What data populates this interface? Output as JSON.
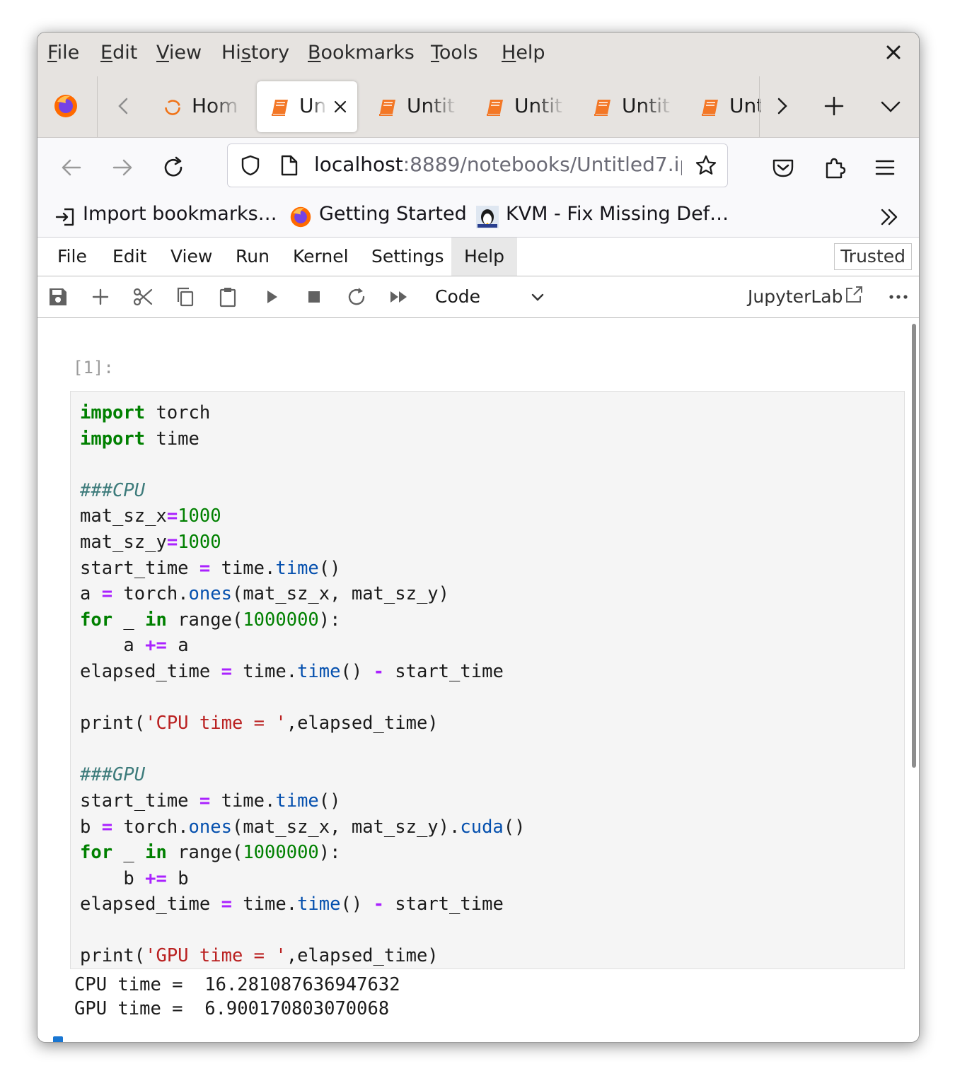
{
  "browser": {
    "menu": [
      "File",
      "Edit",
      "View",
      "History",
      "Bookmarks",
      "Tools",
      "Help"
    ],
    "menu_accel": [
      "F",
      "E",
      "V",
      "s",
      "B",
      "T",
      "H"
    ],
    "tabs": [
      {
        "label": "Hom",
        "icon": "home-loading-icon",
        "active": false
      },
      {
        "label": "Un",
        "icon": "notebook-icon",
        "active": true
      },
      {
        "label": "Untit",
        "icon": "notebook-icon",
        "active": false
      },
      {
        "label": "Untit",
        "icon": "notebook-icon",
        "active": false
      },
      {
        "label": "Untit",
        "icon": "notebook-icon",
        "active": false
      },
      {
        "label": "Unt",
        "icon": "notebook-icon",
        "active": false
      }
    ],
    "url_host": "localhost",
    "url_rest": ":8889/notebooks/Untitled7.ip",
    "bookmarks": [
      {
        "label": "Import bookmarks…",
        "icon": "import-icon"
      },
      {
        "label": "Getting Started",
        "icon": "firefox-icon"
      },
      {
        "label": "KVM - Fix Missing Def…",
        "icon": "tux-icon"
      }
    ]
  },
  "jupyter": {
    "menu": [
      "File",
      "Edit",
      "View",
      "Run",
      "Kernel",
      "Settings",
      "Help"
    ],
    "trusted": "Trusted",
    "cell_type": "Code",
    "jupyterlab_label": "JupyterLab",
    "prompt": "[1]:",
    "output": [
      "CPU time =  16.281087636947632",
      "GPU time =  6.900170803070068"
    ]
  },
  "colors": {
    "keyword": "#008000",
    "operator": "#aa22ff",
    "string": "#ba2121",
    "comment": "#3d7b7b",
    "attribute": "#0550ae",
    "active_cell_marker": "#1976d2"
  }
}
